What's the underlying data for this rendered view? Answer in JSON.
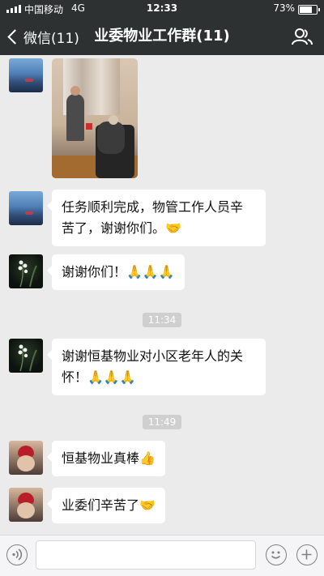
{
  "status": {
    "carrier": "中国移动",
    "network": "4G",
    "time": "12:33",
    "battery": "73%",
    "battery_level": 0.73
  },
  "nav": {
    "back_label": "微信(11)",
    "title": "业委物业工作群(11)"
  },
  "messages": [
    {
      "type": "image",
      "avatar": "sea"
    },
    {
      "type": "text",
      "avatar": "sea",
      "line1": "任务顺利完成，物管工作人员辛",
      "line2": "苦了，谢谢你们。🤝"
    },
    {
      "type": "text",
      "avatar": "flower",
      "line1": "谢谢你们！🙏🙏🙏"
    },
    {
      "type": "time",
      "text": "11:34"
    },
    {
      "type": "text",
      "avatar": "flower",
      "line1": "谢谢恒基物业对小区老年人的关",
      "line2": "怀！🙏🙏🙏"
    },
    {
      "type": "time",
      "text": "11:49"
    },
    {
      "type": "text",
      "avatar": "person",
      "line1": "恒基物业真棒👍"
    },
    {
      "type": "text",
      "avatar": "person",
      "line1": "业委们辛苦了🤝"
    }
  ],
  "input": {
    "placeholder": ""
  },
  "colors": {
    "header": "#2e3132",
    "chat_bg": "#ebebeb",
    "bubble": "#ffffff",
    "timestamp": "#cfcfcf"
  }
}
